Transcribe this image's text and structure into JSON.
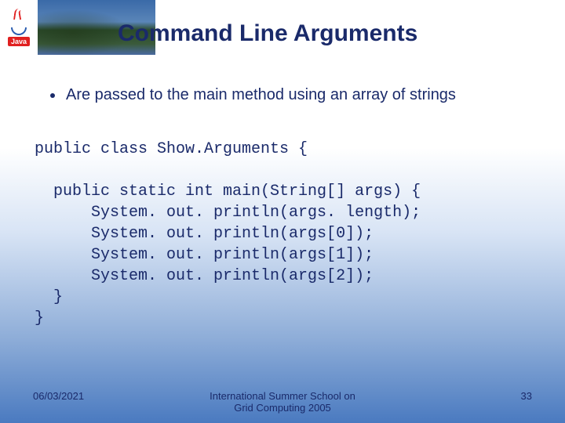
{
  "logo": {
    "label": "Java"
  },
  "title": "Command Line Arguments",
  "bullet": "Are passed to the main method using an array of strings",
  "code": {
    "l1": "public class Show.Arguments {",
    "l2": "  public static int main(String[] args) {",
    "l3": "      System. out. println(args. length);",
    "l4": "      System. out. println(args[0]);",
    "l5": "      System. out. println(args[1]);",
    "l6": "      System. out. println(args[2]);",
    "l7": "  }",
    "l8": "}"
  },
  "footer": {
    "date": "06/03/2021",
    "venue_line1": "International Summer School on",
    "venue_line2": "Grid Computing 2005",
    "page": "33"
  }
}
